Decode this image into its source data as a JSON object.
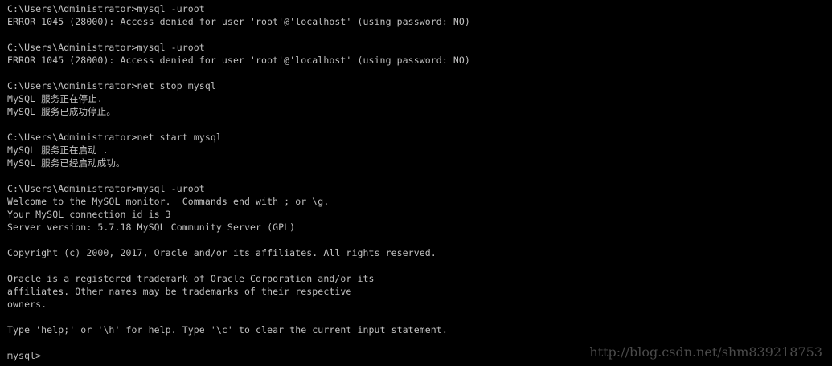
{
  "terminal": {
    "lines": [
      "C:\\Users\\Administrator>mysql -uroot",
      "ERROR 1045 (28000): Access denied for user 'root'@'localhost' (using password: NO)",
      "",
      "C:\\Users\\Administrator>mysql -uroot",
      "ERROR 1045 (28000): Access denied for user 'root'@'localhost' (using password: NO)",
      "",
      "C:\\Users\\Administrator>net stop mysql",
      "MySQL 服务正在停止.",
      "MySQL 服务已成功停止。",
      "",
      "C:\\Users\\Administrator>net start mysql",
      "MySQL 服务正在启动 .",
      "MySQL 服务已经启动成功。",
      "",
      "C:\\Users\\Administrator>mysql -uroot",
      "Welcome to the MySQL monitor.  Commands end with ; or \\g.",
      "Your MySQL connection id is 3",
      "Server version: 5.7.18 MySQL Community Server (GPL)",
      "",
      "Copyright (c) 2000, 2017, Oracle and/or its affiliates. All rights reserved.",
      "",
      "Oracle is a registered trademark of Oracle Corporation and/or its",
      "affiliates. Other names may be trademarks of their respective",
      "owners.",
      "",
      "Type 'help;' or '\\h' for help. Type '\\c' to clear the current input statement.",
      "",
      "mysql>"
    ]
  },
  "watermark": {
    "text": "http://blog.csdn.net/shm839218753"
  },
  "colors": {
    "background": "#000000",
    "foreground": "#c0c0c0"
  }
}
